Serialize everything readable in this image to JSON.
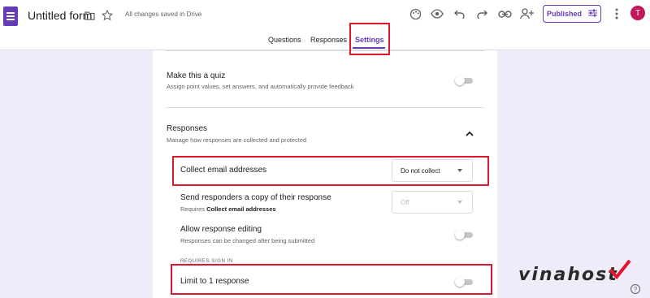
{
  "header": {
    "form_title": "Untitled form",
    "save_status": "All changes saved in Drive",
    "publish_label": "Published",
    "avatar_initial": "T",
    "icons": [
      "forms-logo-icon",
      "folder-icon",
      "star-icon",
      "palette-icon",
      "preview-eye-icon",
      "undo-icon",
      "redo-icon",
      "link-icon",
      "add-person-icon",
      "tune-icon",
      "more-vert-icon"
    ]
  },
  "tabs": [
    {
      "label": "Questions",
      "active": false
    },
    {
      "label": "Responses",
      "active": false
    },
    {
      "label": "Settings",
      "active": true
    }
  ],
  "settings": {
    "quiz": {
      "title": "Make this a quiz",
      "description": "Assign point values, set answers, and automatically provide feedback",
      "enabled": false
    },
    "responses": {
      "title": "Responses",
      "description": "Manage how responses are collected and protected",
      "expanded": true,
      "collect_email": {
        "label": "Collect email addresses",
        "value": "Do not collect"
      },
      "send_copy": {
        "label": "Send responders a copy of their response",
        "requires_prefix": "Requires",
        "requires_value": "Collect email addresses",
        "value": "Off",
        "disabled": true
      },
      "allow_editing": {
        "label": "Allow response editing",
        "description": "Responses can be changed after being submitted",
        "enabled": false
      },
      "requires_sign_in": "REQUIRES SIGN IN",
      "limit_one": {
        "label": "Limit to 1 response",
        "enabled": false
      }
    }
  },
  "watermark": "vinahost",
  "colors": {
    "accent": "#673ab7",
    "highlight": "#e0162b",
    "background": "#f0ebf8"
  }
}
